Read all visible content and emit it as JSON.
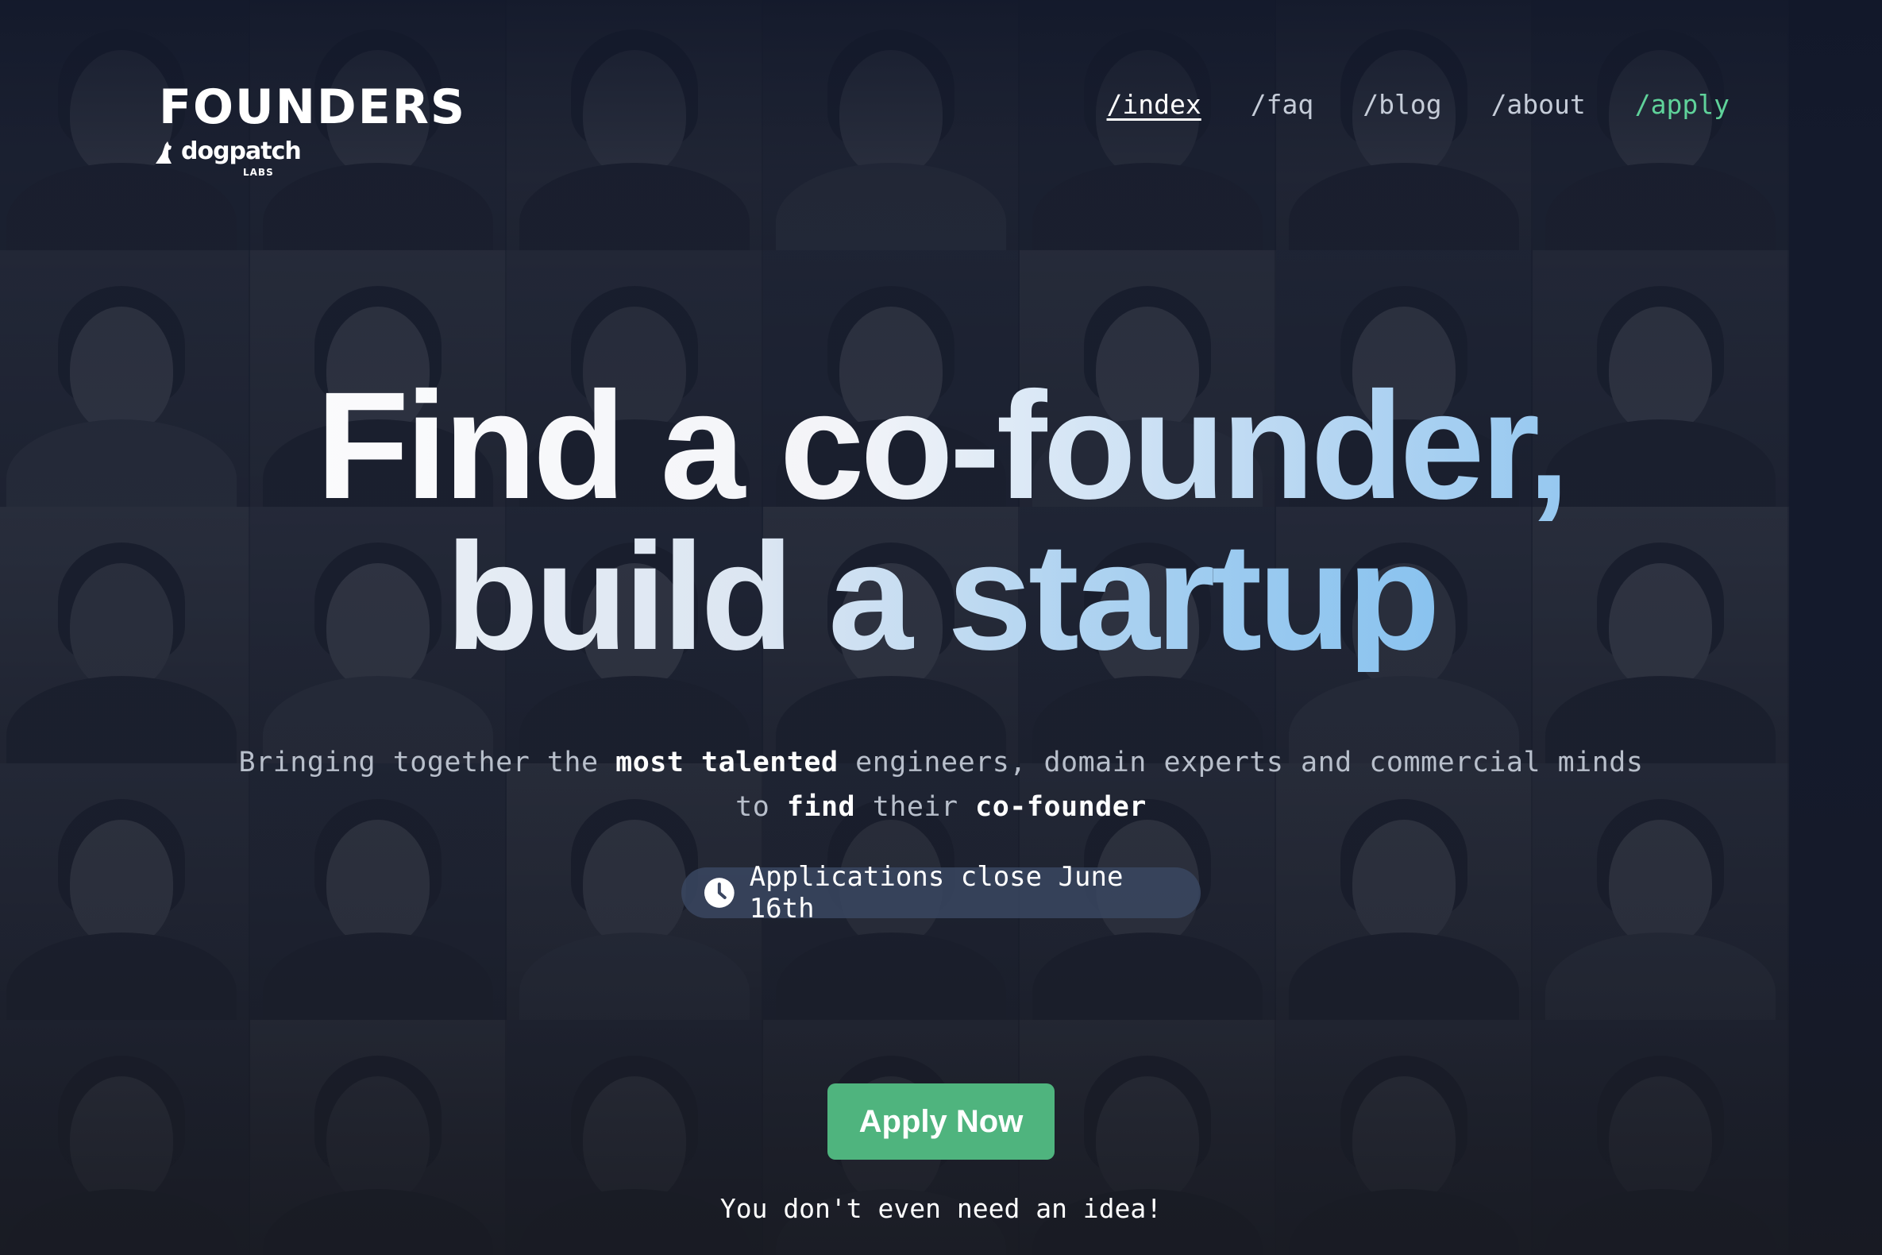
{
  "brand": {
    "name": "FOUNDERS",
    "partner": "dogpatch",
    "partner_suffix": "LABS",
    "partner_icon": "dog-silhouette-icon"
  },
  "nav": {
    "items": [
      {
        "label": "/index",
        "state": "active"
      },
      {
        "label": "/faq",
        "state": "default"
      },
      {
        "label": "/blog",
        "state": "default"
      },
      {
        "label": "/about",
        "state": "default"
      },
      {
        "label": "/apply",
        "state": "accent"
      }
    ]
  },
  "hero": {
    "line1_a": "Find a co-founder,",
    "line2_a": "build a startup"
  },
  "subtitle": {
    "p1": "Bringing together the ",
    "b1": "most talented",
    "p2": " engineers, domain experts and commercial minds",
    "p3": "to ",
    "b2": "find",
    "p4": " their ",
    "b3": "co-founder"
  },
  "badge": {
    "icon": "clock-icon",
    "text": "Applications close June 16th"
  },
  "cta": {
    "label": "Apply Now"
  },
  "tagline": "You don't even need an idea!",
  "colors": {
    "background": "#141a2c",
    "accent_green": "#4fb47e",
    "nav_accent": "#5fd29a",
    "gradient_blue": "#6cb6ee"
  }
}
